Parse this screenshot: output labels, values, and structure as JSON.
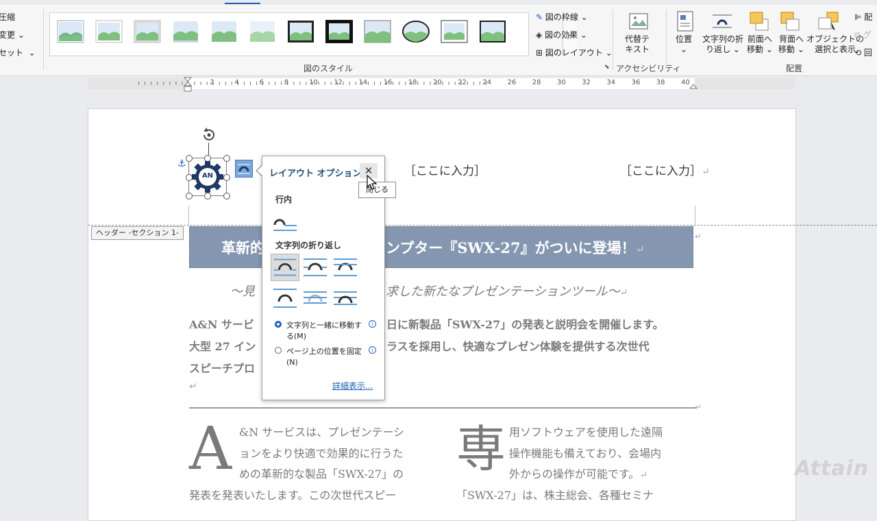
{
  "ribbon": {
    "left_partial_labels": [
      "圧縮",
      "変更",
      "セット"
    ],
    "picture_styles_label": "図のスタイル",
    "picture_border": "図の枠線",
    "picture_effects": "図の効果",
    "picture_layout": "図のレイアウト",
    "alt_text_line1": "代替テ",
    "alt_text_line2": "キスト",
    "accessibility_label": "アクセシビリティ",
    "position": "位置",
    "wrap_text_line1": "文字列の折",
    "wrap_text_line2": "り返し",
    "bring_forward_line1": "前面へ",
    "bring_forward_line2": "移動",
    "send_backward_line1": "背面へ",
    "send_backward_line2": "移動",
    "selection_pane_line1": "オブジェクトの",
    "selection_pane_line2": "選択と表示",
    "arrange_label": "配置",
    "right_partial": [
      "配",
      "グ",
      "回"
    ]
  },
  "ruler": {
    "numbers": [
      "2",
      "4",
      "6",
      "8",
      "10",
      "12",
      "14",
      "16",
      "18",
      "20",
      "22",
      "24",
      "26",
      "28",
      "30",
      "32",
      "34",
      "36",
      "38",
      "40"
    ]
  },
  "document": {
    "logo_text": "AN",
    "header_left": "［ここに入力］",
    "header_right": "［ここに入力］",
    "header_section_tag": "ヘッダー -セクション 1-",
    "title_left": "革新的",
    "title_right": "ンプター『SWX-27』がついに登場！",
    "subtitle_left": "～見",
    "subtitle_right": "求した新たなプレゼンテーションツール～",
    "body_line1_left": "A&N サービ",
    "body_line1_right": "日に新製品「SWX-27」の発表と説明会を開催します。",
    "body_line2_left": "大型 27 イン",
    "body_line2_right": "ラスを採用し、快適なプレゼン体験を提供する次世代",
    "body_line3_left": "スピーチプロ",
    "col1_dropcap": "A",
    "col1_lines": [
      "&N サービスは、プレゼンテーシ",
      "ョンをより快適で効果的に行うた",
      "めの革新的な製品「SWX-27」の",
      "発表を発表いたします。この次世代スピー"
    ],
    "col2_dropcap": "専",
    "col2_lines": [
      "用ソフトウェアを使用した遠隔",
      "操作機能も備えており、会場内",
      "外からの操作が可能です。",
      "「SWX-27」は、株主総会、各種セミナ"
    ]
  },
  "layout_popup": {
    "title": "レイアウト オプション",
    "close_tooltip": "閉じる",
    "section_inline": "行内",
    "section_wrap": "文字列の折り返し",
    "option_move_with_text_line1": "文字列と一緒に移動す",
    "option_move_with_text_line2": "る(M)",
    "option_fix_position_line1": "ページ上の位置を固定",
    "option_fix_position_line2": "(N)",
    "see_more": "詳細表示..."
  },
  "watermark": "Attain",
  "colors": {
    "accent": "#185abd",
    "title_bar": "#8496b0",
    "popup_title": "#1f4e79",
    "link": "#1f5fb7"
  }
}
